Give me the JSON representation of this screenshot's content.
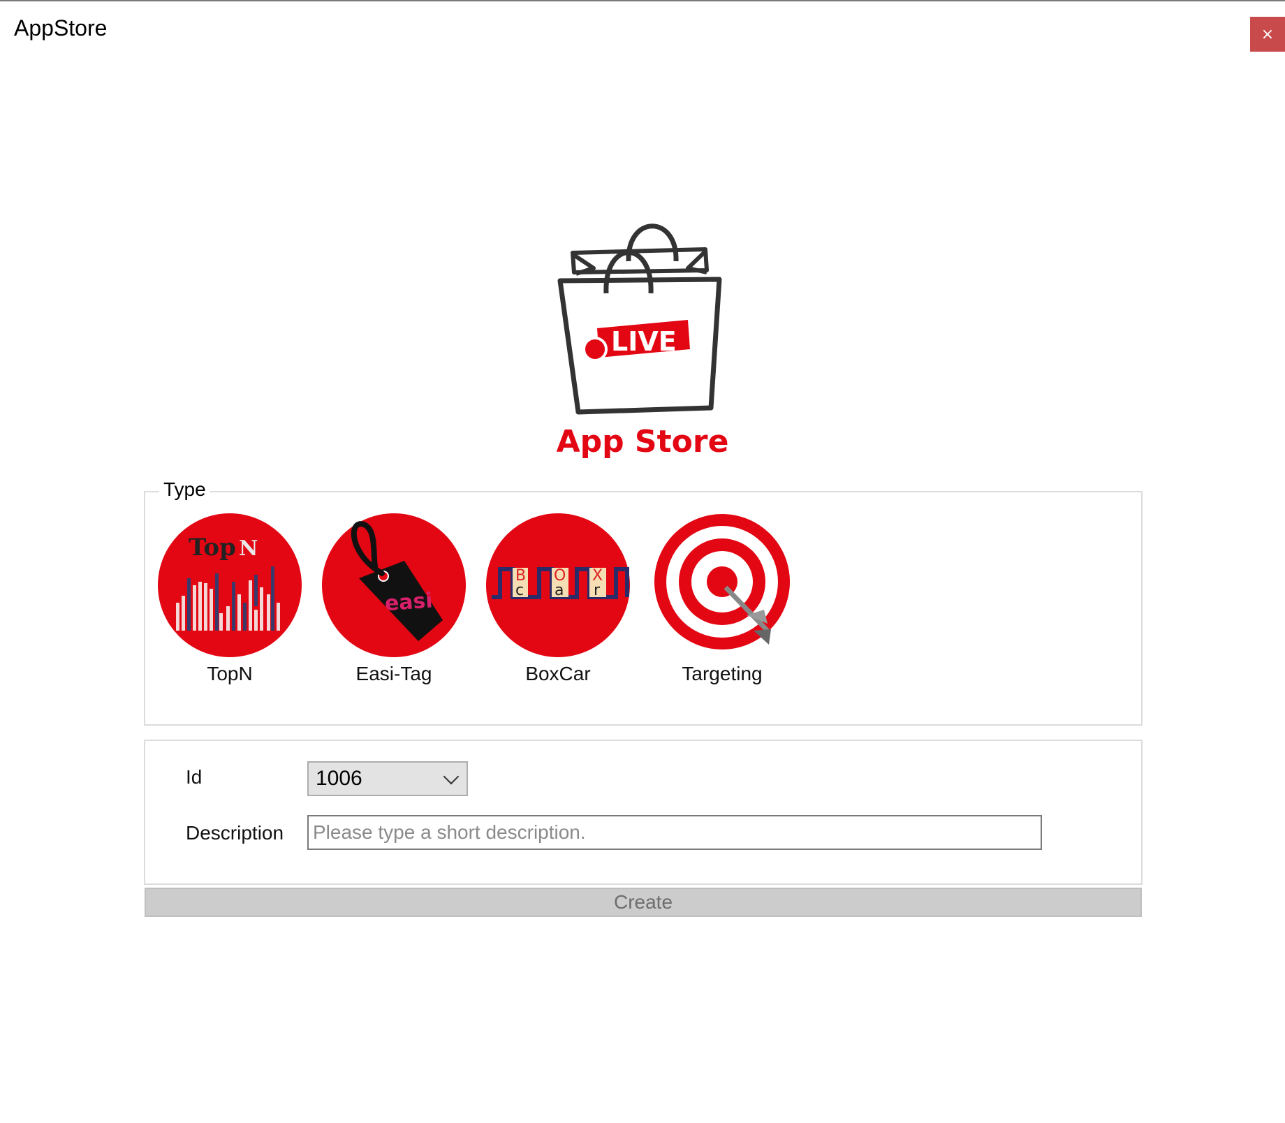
{
  "window": {
    "title": "AppStore",
    "close_label": "×"
  },
  "logo": {
    "badge_text": "LIVE",
    "brand_text": "App Store"
  },
  "type_group": {
    "legend": "Type",
    "items": [
      {
        "label": "TopN",
        "icon": "topn-icon",
        "icon_text_1": "Top",
        "icon_text_2": "N"
      },
      {
        "label": "Easi-Tag",
        "icon": "tag-icon",
        "icon_text_1": "easi"
      },
      {
        "label": "BoxCar",
        "icon": "boxcar-icon",
        "icon_text_1": "B",
        "icon_text_2": "O",
        "icon_text_3": "X",
        "icon_text_4": "c",
        "icon_text_5": "a",
        "icon_text_6": "r"
      },
      {
        "label": "Targeting",
        "icon": "target-icon"
      }
    ]
  },
  "form": {
    "id_label": "Id",
    "id_value": "1006",
    "description_label": "Description",
    "description_placeholder": "Please type a short description.",
    "description_value": ""
  },
  "actions": {
    "create_label": "Create"
  },
  "colors": {
    "brand_red": "#e30613",
    "close_red": "#c94a4a",
    "button_gray": "#cccccc"
  }
}
